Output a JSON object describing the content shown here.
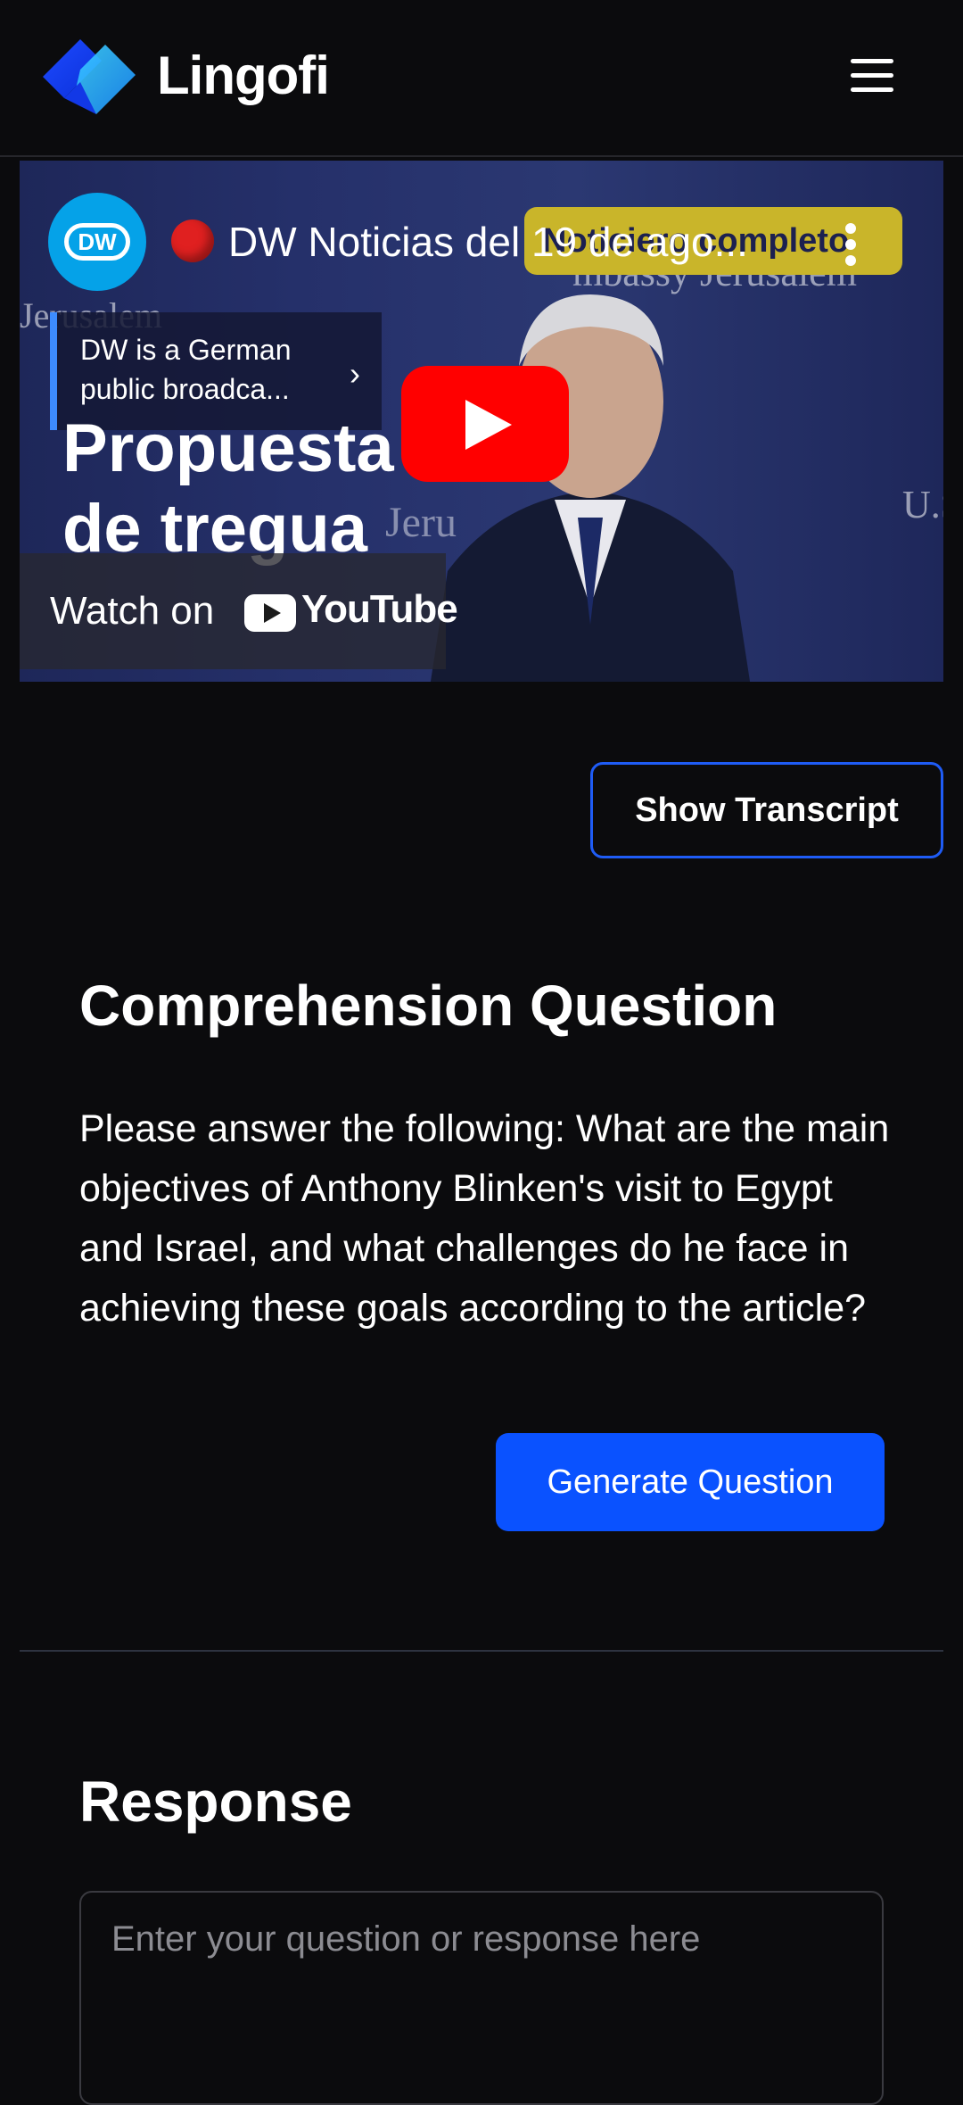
{
  "header": {
    "brand": "Lingofi",
    "menu_icon": "hamburger-menu-icon"
  },
  "video": {
    "channel": "DW",
    "title": "DW Noticias del 19 de ago...",
    "badge": "Noticiero completo",
    "info_card": "DW is a German public broadca...",
    "overlay_title_line1": "Propuesta",
    "overlay_title_line2": "de tregua",
    "background_text_1": "Jerusalem",
    "background_text_2": "mbassy Jerusalem",
    "background_text_3": "U.S",
    "background_text_4": "Jeru",
    "watch_on": "Watch on",
    "youtube": "YouTube"
  },
  "transcript_button": "Show Transcript",
  "comprehension": {
    "title": "Comprehension Question",
    "question": "Please answer the following: What are the main objectives of Anthony Blinken's visit to Egypt and Israel, and what challenges do he face in achieving these goals according to the article?",
    "generate_button": "Generate Question"
  },
  "response": {
    "title": "Response",
    "placeholder": "Enter your question or response here"
  },
  "colors": {
    "background": "#0b0b0d",
    "accent": "#0a52ff",
    "outline_accent": "#1f5cf5",
    "youtube_red": "#ff0000",
    "dw_blue": "#05a2e8",
    "badge_yellow": "#c9b52a"
  }
}
